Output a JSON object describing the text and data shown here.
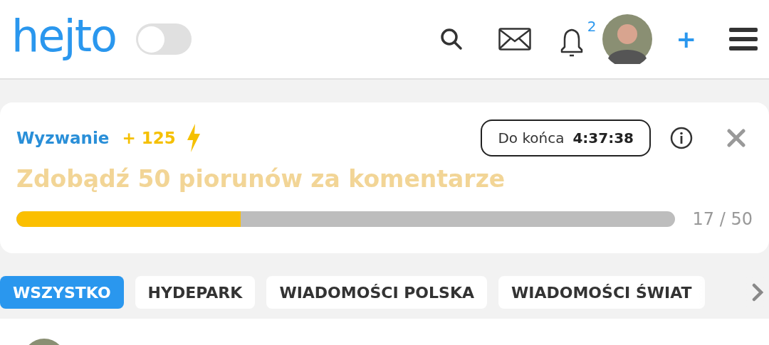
{
  "header": {
    "logo": "hejto",
    "theme_toggle": {
      "on": false
    },
    "notifications_count": "2",
    "add_label": "+"
  },
  "challenge": {
    "label": "Wyzwanie",
    "reward": "+ 125",
    "timer_label": "Do końca",
    "timer_value": "4:37:38",
    "title": "Zdobądź 50 piorunów za komentarze",
    "level": 0.34,
    "progress_text": "17 / 50"
  },
  "tabs": [
    {
      "label": "WSZYSTKO",
      "selected": true
    },
    {
      "label": "HYDEPARK",
      "selected": false
    },
    {
      "label": "WIADOMOŚCI POLSKA",
      "selected": false
    },
    {
      "label": "WIADOMOŚCI ŚWIAT",
      "selected": false
    }
  ]
}
